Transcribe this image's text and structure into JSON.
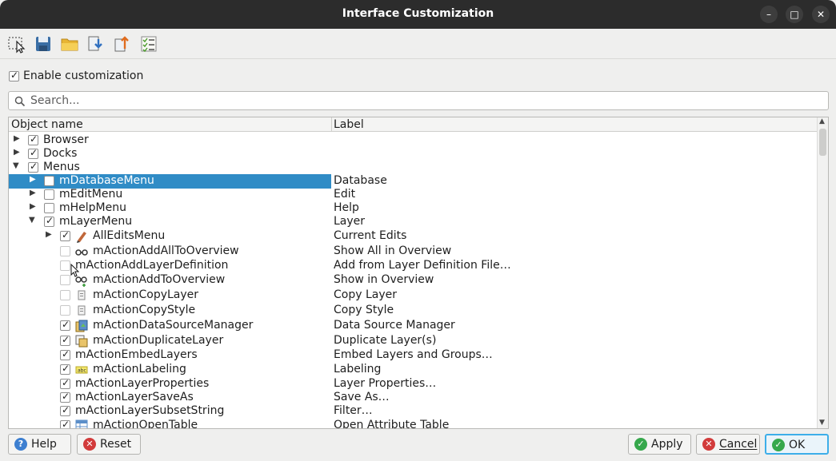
{
  "window": {
    "title": "Interface Customization"
  },
  "enable": {
    "label": "Enable customization",
    "checked": true
  },
  "search": {
    "placeholder": "Search..."
  },
  "columns": {
    "object_name": "Object name",
    "label": "Label"
  },
  "rows": [
    {
      "name": "Browser",
      "label": ""
    },
    {
      "name": "Docks",
      "label": ""
    },
    {
      "name": "Menus",
      "label": ""
    },
    {
      "name": "mDatabaseMenu",
      "label": "Database"
    },
    {
      "name": "mEditMenu",
      "label": "Edit"
    },
    {
      "name": "mHelpMenu",
      "label": "Help"
    },
    {
      "name": "mLayerMenu",
      "label": "Layer"
    },
    {
      "name": "AllEditsMenu",
      "label": "Current Edits"
    },
    {
      "name": "mActionAddAllToOverview",
      "label": "Show All in Overview"
    },
    {
      "name": "mActionAddLayerDefinition",
      "label": "Add from Layer Definition File…"
    },
    {
      "name": "mActionAddToOverview",
      "label": "Show in Overview"
    },
    {
      "name": "mActionCopyLayer",
      "label": "Copy Layer"
    },
    {
      "name": "mActionCopyStyle",
      "label": "Copy Style"
    },
    {
      "name": "mActionDataSourceManager",
      "label": "Data Source Manager"
    },
    {
      "name": "mActionDuplicateLayer",
      "label": "Duplicate Layer(s)"
    },
    {
      "name": "mActionEmbedLayers",
      "label": "Embed Layers and Groups…"
    },
    {
      "name": "mActionLabeling",
      "label": "Labeling"
    },
    {
      "name": "mActionLayerProperties",
      "label": "Layer Properties…"
    },
    {
      "name": "mActionLayerSaveAs",
      "label": "Save As…"
    },
    {
      "name": "mActionLayerSubsetString",
      "label": "Filter…"
    },
    {
      "name": "mActionOpenTable",
      "label": "Open Attribute Table"
    }
  ],
  "buttons": {
    "help": "Help",
    "reset": "Reset",
    "apply": "Apply",
    "cancel": "Cancel",
    "ok": "OK"
  },
  "icons": [
    "select-widget-icon",
    "save-icon",
    "open-folder-icon",
    "load-icon",
    "export-icon",
    "checklist-icon"
  ],
  "colors": {
    "selection": "#308cc6",
    "title_bar": "#2c2c2c",
    "ok_focus": "#3daee9"
  }
}
